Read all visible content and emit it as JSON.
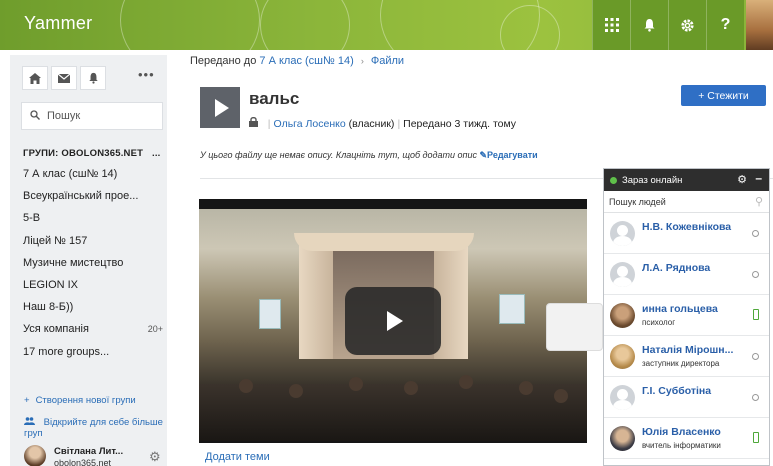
{
  "header": {
    "brand": "Yammer",
    "apps_icon": "apps-grid-icon",
    "bell_icon": "bell-icon",
    "settings_icon": "gear-icon",
    "help_label": "?"
  },
  "sidebar": {
    "search_placeholder": "Пошук",
    "groups_heading": "ГРУПИ: OBOLON365.NET",
    "groups_heading_more": "...",
    "groups": [
      {
        "label": "7 А клас (сш№ 14)",
        "count": ""
      },
      {
        "label": "Всеукраїнський прое...",
        "count": ""
      },
      {
        "label": "5-В",
        "count": ""
      },
      {
        "label": "Ліцей № 157",
        "count": ""
      },
      {
        "label": "Музичне мистецтво",
        "count": ""
      },
      {
        "label": "LEGION IX",
        "count": ""
      },
      {
        "label": "Наш 8-Б))",
        "count": ""
      },
      {
        "label": "Уся компанія",
        "count": "20+"
      },
      {
        "label": "17 more groups...",
        "count": ""
      }
    ],
    "create_group": "Створення нової групи",
    "discover_groups": "Відкрийте для себе більше груп",
    "user_name": "Світлана Лит...",
    "user_domain": "obolon365.net"
  },
  "breadcrumb": {
    "prefix": "Передано до",
    "group": "7 А клас (сш№ 14)",
    "files": "Файли"
  },
  "file": {
    "title": "вальс",
    "owner": "Ольга Лосенко",
    "owner_role": "(власник)",
    "shared": "Передано 3 тижд. тому",
    "follow_label": "+ Стежити",
    "description": "У цього файлу ще немає опису. Клацніть тут, щоб додати опис",
    "edit_label": "Редагувати",
    "add_topics": "Додати теми"
  },
  "online": {
    "title": "Зараз онлайн",
    "search_placeholder": "Пошук людей",
    "people": [
      {
        "name": "Н.В. Кожевнікова",
        "role": "",
        "avatar": "blank",
        "status": "offline"
      },
      {
        "name": "Л.А. Ряднова",
        "role": "",
        "avatar": "blank",
        "status": "offline"
      },
      {
        "name": "инна гольцева",
        "role": "психолог",
        "avatar": "photo1",
        "status": "mobile"
      },
      {
        "name": "Наталія Мірошн...",
        "role": "заступник директора",
        "avatar": "photo2",
        "status": "offline"
      },
      {
        "name": "Г.І. Субботіна",
        "role": "",
        "avatar": "blank",
        "status": "offline"
      },
      {
        "name": "Юлія Власенко",
        "role": "вчитель інформатики",
        "avatar": "photo3",
        "status": "mobile"
      }
    ]
  }
}
